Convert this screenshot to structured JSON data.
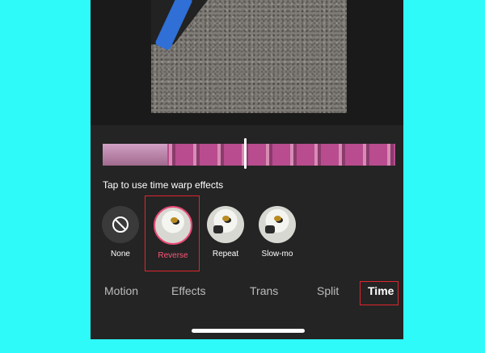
{
  "hint": "Tap to use time warp effects",
  "effects": [
    {
      "label": "None",
      "icon": "none-icon"
    },
    {
      "label": "Reverse",
      "selected": true
    },
    {
      "label": "Repeat"
    },
    {
      "label": "Slow-mo"
    }
  ],
  "tabs": [
    "Motion",
    "Effects",
    "Trans",
    "Split",
    "Time"
  ],
  "active_tab": "Time",
  "colors": {
    "selected": "#e74a76",
    "highlight_box": "#e0262e",
    "background": "#2efbf9"
  }
}
